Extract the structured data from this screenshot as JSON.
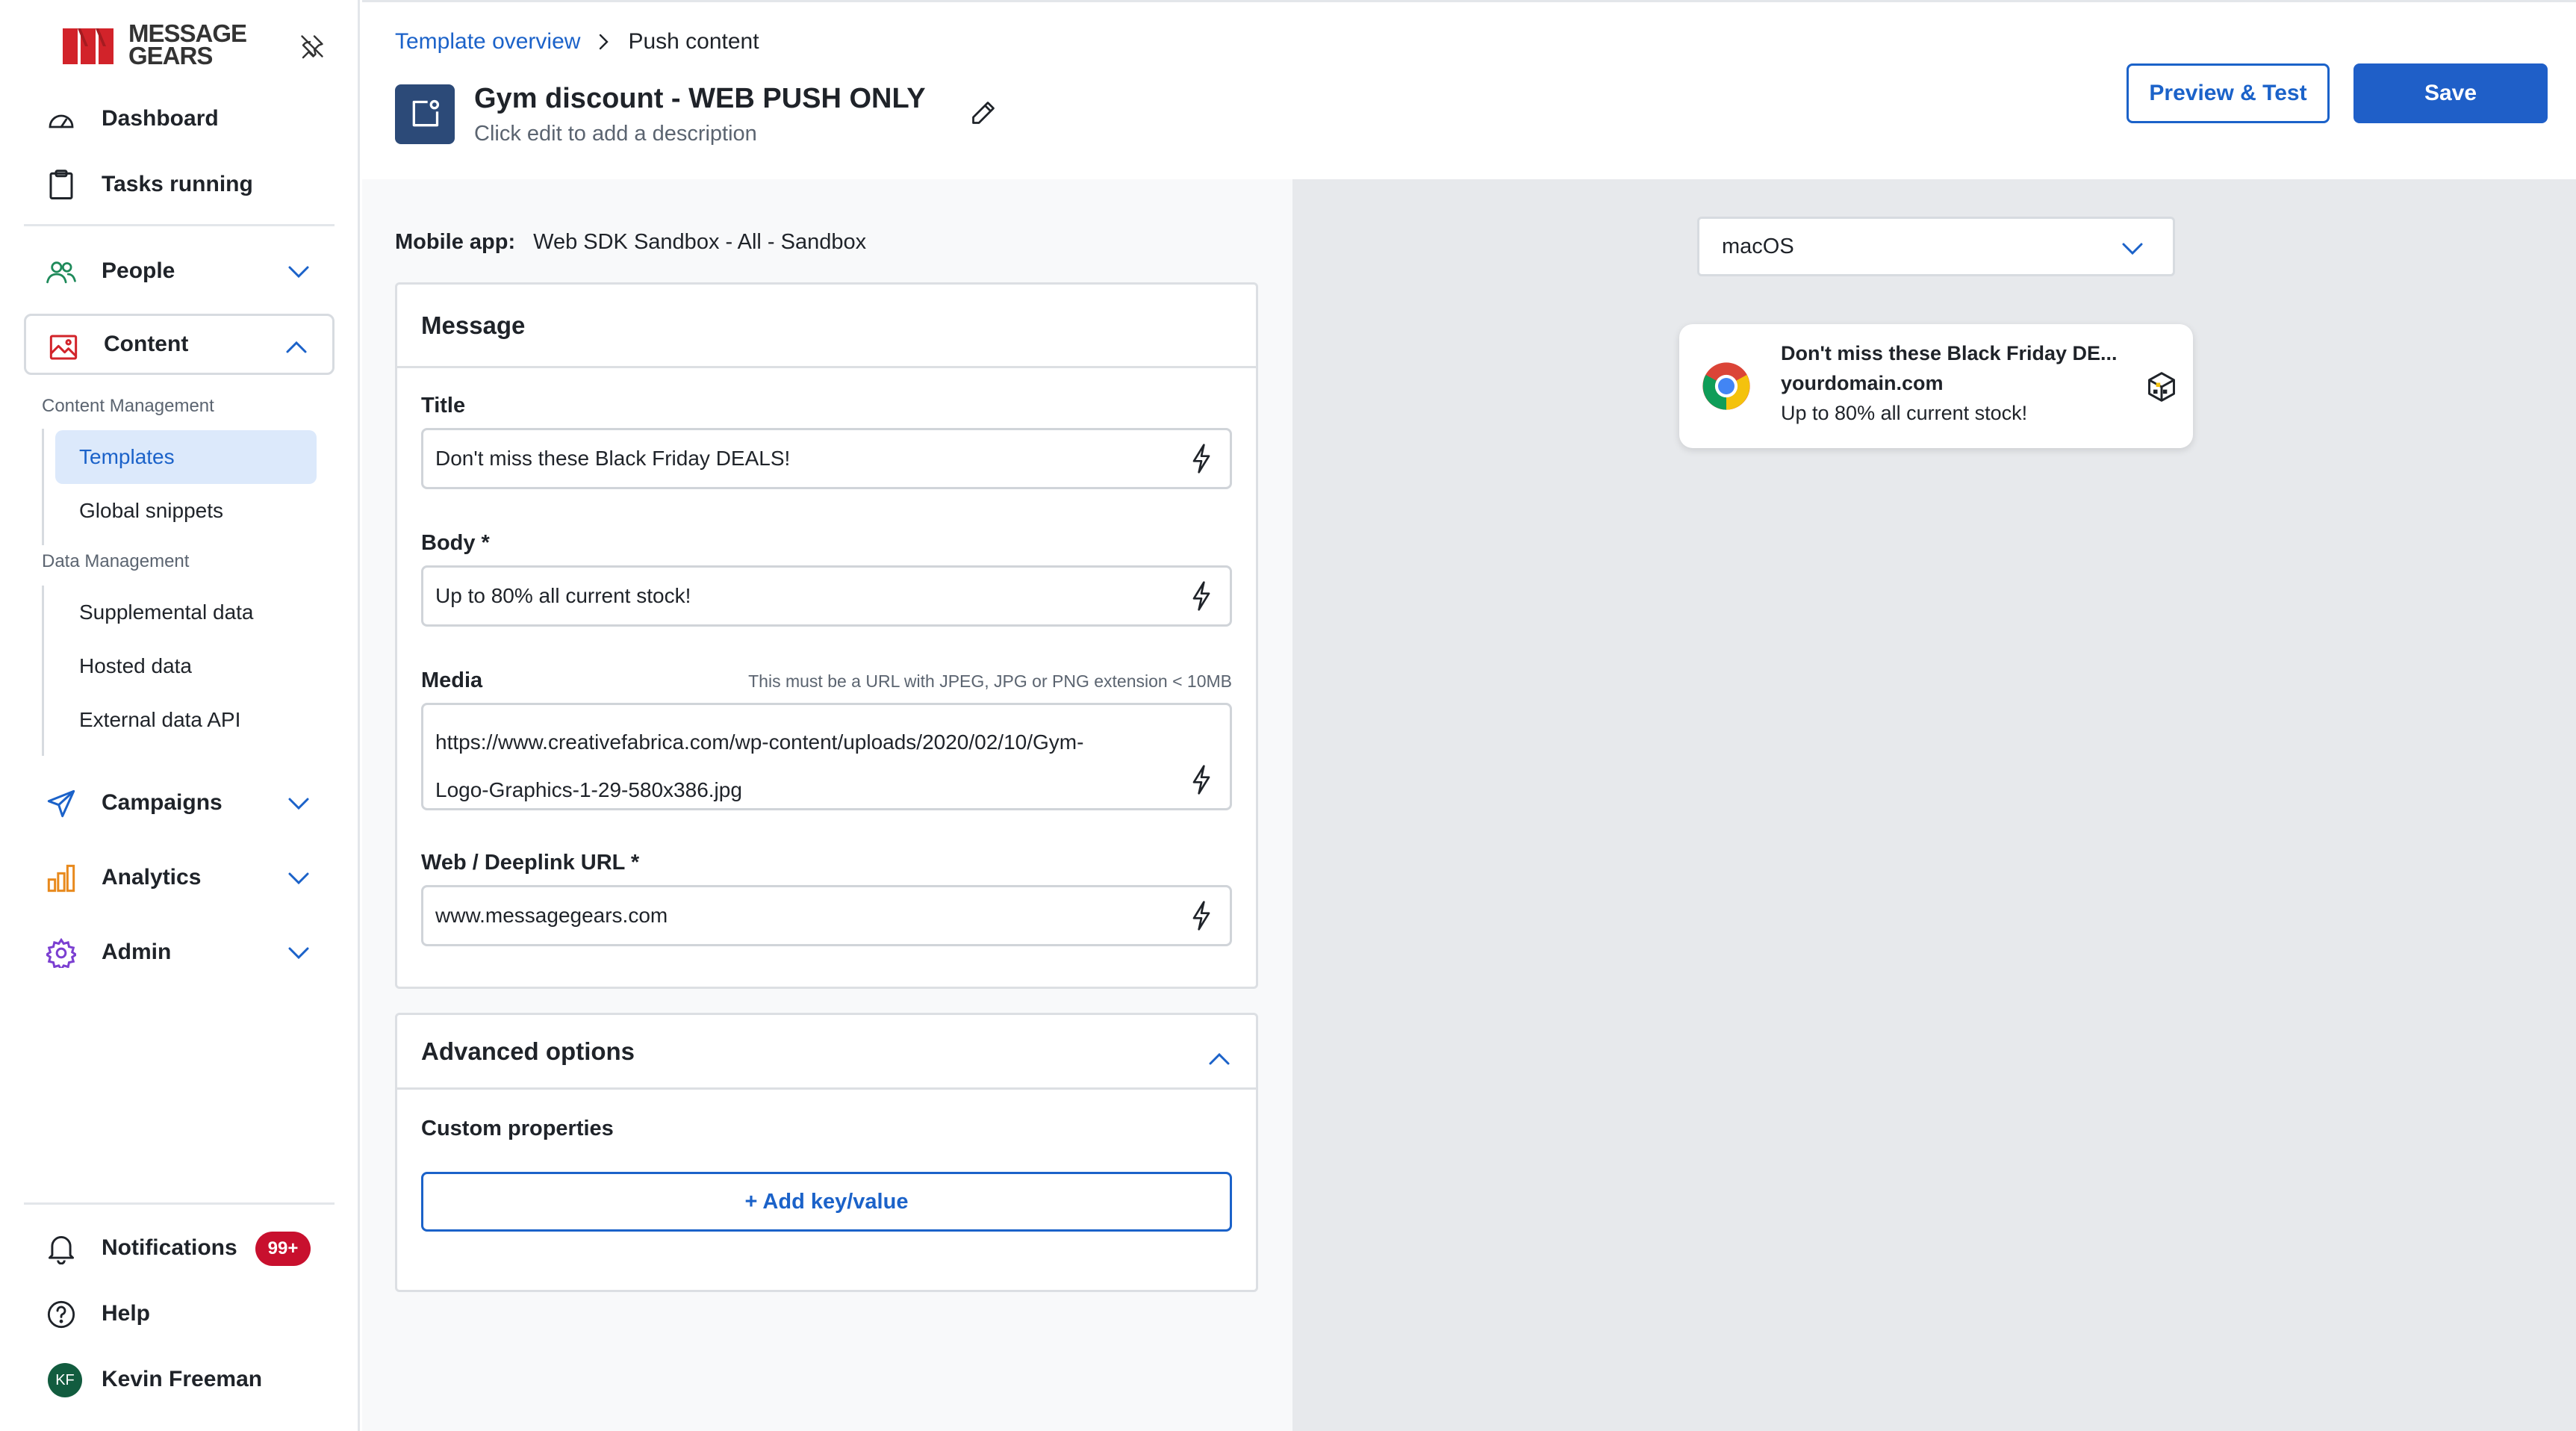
{
  "brand": {
    "line1": "MESSAGE",
    "line2": "GEARS"
  },
  "sidebar": {
    "dashboard": "Dashboard",
    "tasks": "Tasks running",
    "people": "People",
    "content": "Content",
    "content_management_label": "Content Management",
    "templates": "Templates",
    "global_snippets": "Global snippets",
    "data_management_label": "Data Management",
    "supplemental_data": "Supplemental data",
    "hosted_data": "Hosted data",
    "external_data_api": "External data API",
    "campaigns": "Campaigns",
    "analytics": "Analytics",
    "admin": "Admin",
    "notifications": "Notifications",
    "notifications_badge": "99+",
    "help": "Help",
    "user_initials": "KF",
    "user_name": "Kevin Freeman"
  },
  "header": {
    "breadcrumb_parent": "Template overview",
    "breadcrumb_current": "Push content",
    "title": "Gym discount - WEB PUSH ONLY",
    "description": "Click edit to add a description",
    "preview_button": "Preview & Test",
    "save_button": "Save"
  },
  "form": {
    "mobile_app_label": "Mobile app:",
    "mobile_app_value": "Web SDK Sandbox - All - Sandbox",
    "message_heading": "Message",
    "title_label": "Title",
    "title_value": "Don't miss these Black Friday DEALS!",
    "body_label": "Body *",
    "body_value": "Up to 80% all current stock!",
    "media_label": "Media",
    "media_hint": "This must be a URL with JPEG, JPG or PNG extension < 10MB",
    "media_value_line1": "https://www.creativefabrica.com/wp-content/uploads/2020/02/10/Gym-",
    "media_value_line2": "Logo-Graphics-1-29-580x386.jpg",
    "url_label": "Web / Deeplink URL *",
    "url_value": "www.messagegears.com",
    "advanced_heading": "Advanced options",
    "custom_properties_label": "Custom properties",
    "add_key_value_button": "+ Add key/value"
  },
  "preview": {
    "os_selected": "macOS",
    "notification_title": "Don't miss these Black Friday DE...",
    "notification_domain": "yourdomain.com",
    "notification_body": "Up to 80% all current stock!"
  },
  "colors": {
    "accent": "#1b62c9",
    "primary_button": "#1f5fc8",
    "selected_bg": "#dce9fb",
    "badge": "#c8102e",
    "brand_red": "#d2232a",
    "preview_bg": "#e7e9ec"
  },
  "icons": {
    "dashboard": "gauge-icon",
    "tasks": "clipboard-icon",
    "people": "people-icon",
    "content": "image-icon",
    "campaigns": "paper-plane-icon",
    "analytics": "bar-chart-icon",
    "admin": "gear-icon",
    "notifications": "bell-icon",
    "help": "help-circle-icon",
    "pin": "unpin-icon",
    "edit": "pencil-icon",
    "field_action": "lightning-icon",
    "browser": "chrome-icon",
    "media": "media-box-icon"
  }
}
